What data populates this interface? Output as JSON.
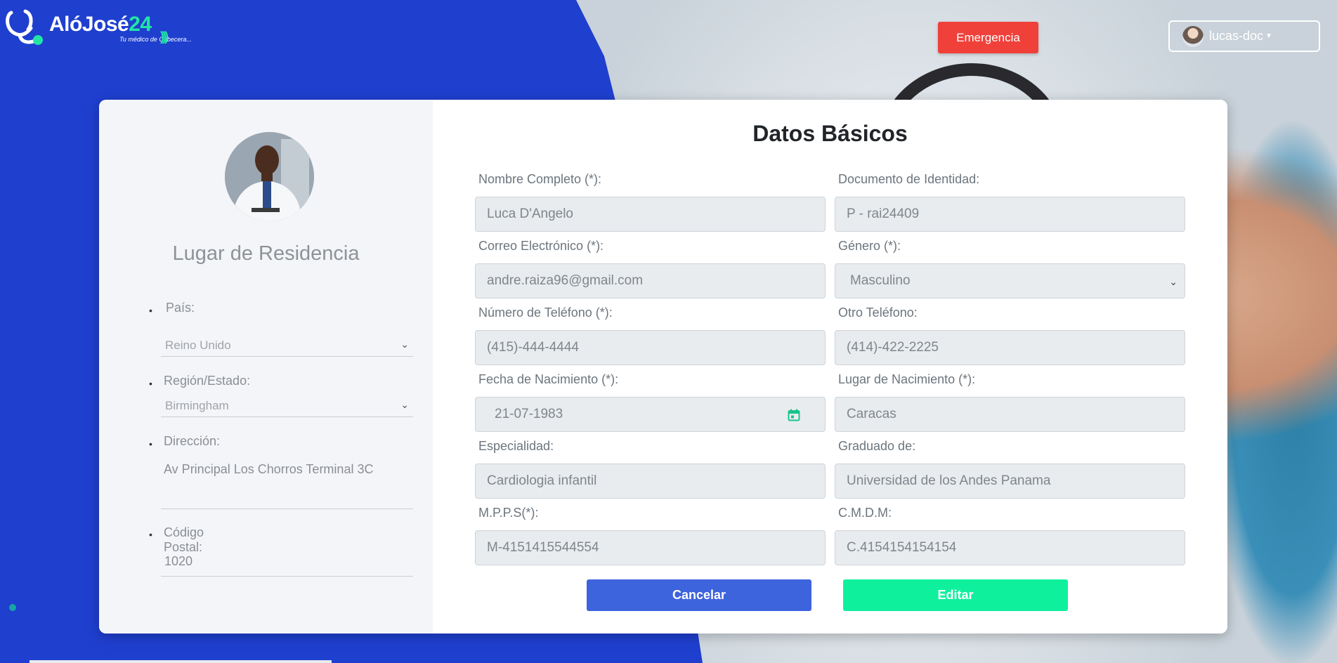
{
  "header": {
    "logo_name_part1": "AlóJosé",
    "logo_name_part2": "24",
    "logo_tagline": "Tu médico de Cabecera...",
    "emergency_label": "Emergencia",
    "user_label": "lucas-doc"
  },
  "sidebar": {
    "title": "Lugar de Residencia",
    "country_label": "País:",
    "country_value": "Reino Unido",
    "region_label": "Región/Estado:",
    "region_value": "Birmingham",
    "address_label": "Dirección:",
    "address_value": "Av Principal Los Chorros Terminal 3C",
    "postal_label": "Código Postal:",
    "postal_value": "1020"
  },
  "form": {
    "title": "Datos Básicos",
    "fields": [
      {
        "label": "Nombre Completo (*):",
        "value": "Luca D'Angelo"
      },
      {
        "label": "Documento de Identidad:",
        "value": "P - rai24409"
      },
      {
        "label": "Correo Electrónico (*):",
        "value": "andre.raiza96@gmail.com"
      },
      {
        "label": "Género (*):",
        "value": "Masculino"
      },
      {
        "label": "Número de Teléfono (*):",
        "value": "(415)-444-4444"
      },
      {
        "label": "Otro Teléfono:",
        "value": "(414)-422-2225"
      },
      {
        "label": "Fecha de Nacimiento (*):",
        "value": "21-07-1983"
      },
      {
        "label": "Lugar de Nacimiento (*):",
        "value": "Caracas"
      },
      {
        "label": "Especialidad:",
        "value": "Cardiologia infantil"
      },
      {
        "label": "Graduado de:",
        "value": "Universidad de los Andes Panama"
      },
      {
        "label": "M.P.P.S(*):",
        "value": "M-4151415544554"
      },
      {
        "label": "C.M.D.M:",
        "value": "C.4154154154154"
      }
    ],
    "cancel_label": "Cancelar",
    "edit_label": "Editar"
  },
  "colors": {
    "primary_blue": "#1f3fcf",
    "emergency_red": "#f0403a",
    "cancel_blue": "#3d63dd",
    "edit_green": "#0ff09d",
    "accent_teal": "#22e5a5"
  },
  "icons": [
    "stethoscope-logo-icon",
    "signal-waves-icon",
    "chevron-down-icon",
    "calendar-icon",
    "caret-down-icon"
  ]
}
